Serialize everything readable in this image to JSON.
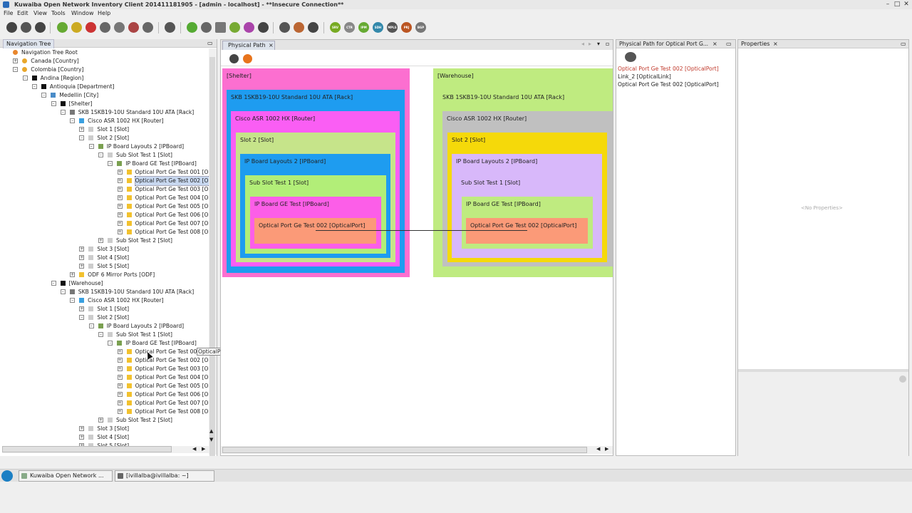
{
  "window": {
    "title": "Kuwaiba Open Network Inventory Client 201411181905 - [admin - localhost] - **Insecure Connection**"
  },
  "menu": [
    "File",
    "Edit",
    "View",
    "Tools",
    "Window",
    "Help"
  ],
  "toolbar_badges": [
    "SRV",
    "CTR",
    "IPM",
    "SDH",
    "MPLS",
    "PRJ",
    "BGP"
  ],
  "nav": {
    "title": "Navigation Tree",
    "rows": [
      {
        "label": "Navigation Tree Root",
        "icon": "star"
      },
      {
        "label": "Canada [Country]",
        "icon": "pin"
      },
      {
        "label": "Colombia [Country]",
        "icon": "pin"
      },
      {
        "label": "Andina [Region]",
        "icon": "black"
      },
      {
        "label": "Antioquia [Department]",
        "icon": "black"
      },
      {
        "label": "Medellin [City]",
        "icon": "city"
      },
      {
        "label": "[Shelter]",
        "icon": "black"
      },
      {
        "label": "SKB 1SKB19-10U Standard 10U ATA [Rack]",
        "icon": "rack"
      },
      {
        "label": "Cisco ASR 1002 HX [Router]",
        "icon": "router"
      },
      {
        "label": "Slot 1 [Slot]",
        "icon": "slot"
      },
      {
        "label": "Slot 2 [Slot]",
        "icon": "slot"
      },
      {
        "label": "IP Board Layouts 2 [IPBoard]",
        "icon": "board"
      },
      {
        "label": "Sub Slot Test 1 [Slot]",
        "icon": "slot"
      },
      {
        "label": "IP Board GE Test [IPBoard]",
        "icon": "board"
      },
      {
        "label": "Optical Port Ge Test 001 [Opt",
        "icon": "port"
      },
      {
        "label": "Optical Port Ge Test 002 [Opt",
        "icon": "port"
      },
      {
        "label": "Optical Port Ge Test 003 [Opt",
        "icon": "port"
      },
      {
        "label": "Optical Port Ge Test 004 [Opt",
        "icon": "port"
      },
      {
        "label": "Optical Port Ge Test 005 [Opt",
        "icon": "port"
      },
      {
        "label": "Optical Port Ge Test 006 [Opt",
        "icon": "port"
      },
      {
        "label": "Optical Port Ge Test 007 [Opt",
        "icon": "port"
      },
      {
        "label": "Optical Port Ge Test 008 [Opt",
        "icon": "port"
      },
      {
        "label": "Sub Slot Test 2 [Slot]",
        "icon": "slot"
      },
      {
        "label": "Slot 3 [Slot]",
        "icon": "slot"
      },
      {
        "label": "Slot 4 [Slot]",
        "icon": "slot"
      },
      {
        "label": "Slot 5 [Slot]",
        "icon": "slot"
      },
      {
        "label": "ODF 6 Mirror Ports [ODF]",
        "icon": "odf"
      },
      {
        "label": "[Warehouse]",
        "icon": "black"
      },
      {
        "label": "SKB 1SKB19-10U Standard 10U ATA [Rack]",
        "icon": "rack"
      },
      {
        "label": "Cisco ASR 1002 HX [Router]",
        "icon": "router"
      },
      {
        "label": "Slot 1 [Slot]",
        "icon": "slot"
      },
      {
        "label": "Slot 2 [Slot]",
        "icon": "slot"
      },
      {
        "label": "IP Board Layouts 2 [IPBoard]",
        "icon": "board"
      },
      {
        "label": "Sub Slot Test 1 [Slot]",
        "icon": "slot"
      },
      {
        "label": "IP Board GE Test [IPBoard]",
        "icon": "board"
      },
      {
        "label": "Optical Port Ge Test 001",
        "icon": "port"
      },
      {
        "label": "Optical Port Ge Test 002 [Opt",
        "icon": "port"
      },
      {
        "label": "Optical Port Ge Test 003 [Opt",
        "icon": "port"
      },
      {
        "label": "Optical Port Ge Test 004 [Opt",
        "icon": "port"
      },
      {
        "label": "Optical Port Ge Test 005 [Opt",
        "icon": "port"
      },
      {
        "label": "Optical Port Ge Test 006 [Opt",
        "icon": "port"
      },
      {
        "label": "Optical Port Ge Test 007 [Opt",
        "icon": "port"
      },
      {
        "label": "Optical Port Ge Test 008 [Opt",
        "icon": "port"
      },
      {
        "label": "Sub Slot Test 2 [Slot]",
        "icon": "slot"
      },
      {
        "label": "Slot 3 [Slot]",
        "icon": "slot"
      },
      {
        "label": "Slot 4 [Slot]",
        "icon": "slot"
      },
      {
        "label": "Slot 5 [Slot]",
        "icon": "slot"
      }
    ],
    "tooltip": "OpticalPort]"
  },
  "physical_path": {
    "tab": "Physical Path",
    "left": {
      "shelter": "[Shelter]",
      "rack": "SKB 1SKB19-10U Standard 10U ATA [Rack]",
      "router": "Cisco ASR 1002 HX [Router]",
      "slot": "Slot 2 [Slot]",
      "board": "IP Board Layouts 2 [IPBoard]",
      "subslot": "Sub Slot Test 1 [Slot]",
      "geboard": "IP Board GE Test [IPBoard]",
      "port": "Optical Port Ge Test 002 [OpticalPort]"
    },
    "right": {
      "shelter": "[Warehouse]",
      "rack": "SKB 1SKB19-10U Standard 10U ATA [Rack]",
      "router": "Cisco ASR 1002 HX [Router]",
      "slot": "Slot 2 [Slot]",
      "board": "IP Board Layouts 2 [IPBoard]",
      "subslot": "Sub Slot Test 1 [Slot]",
      "geboard": "IP Board GE Test [IPBoard]",
      "port": "Optical Port Ge Test 002 [OpticalPort]"
    }
  },
  "path_panel": {
    "title": "Physical Path for Optical Port G...",
    "items": [
      "Optical Port Ge Test 002 [OpticalPort]",
      "Link_2 [OpticalLink]",
      "Optical Port Ge Test 002 [OpticalPort]"
    ]
  },
  "properties": {
    "title": "Properties",
    "empty": "<No Properties>"
  },
  "taskbar": {
    "items": [
      "Kuwaiba Open Network ...",
      "[ivillalba@ivillalba: ~]"
    ]
  }
}
